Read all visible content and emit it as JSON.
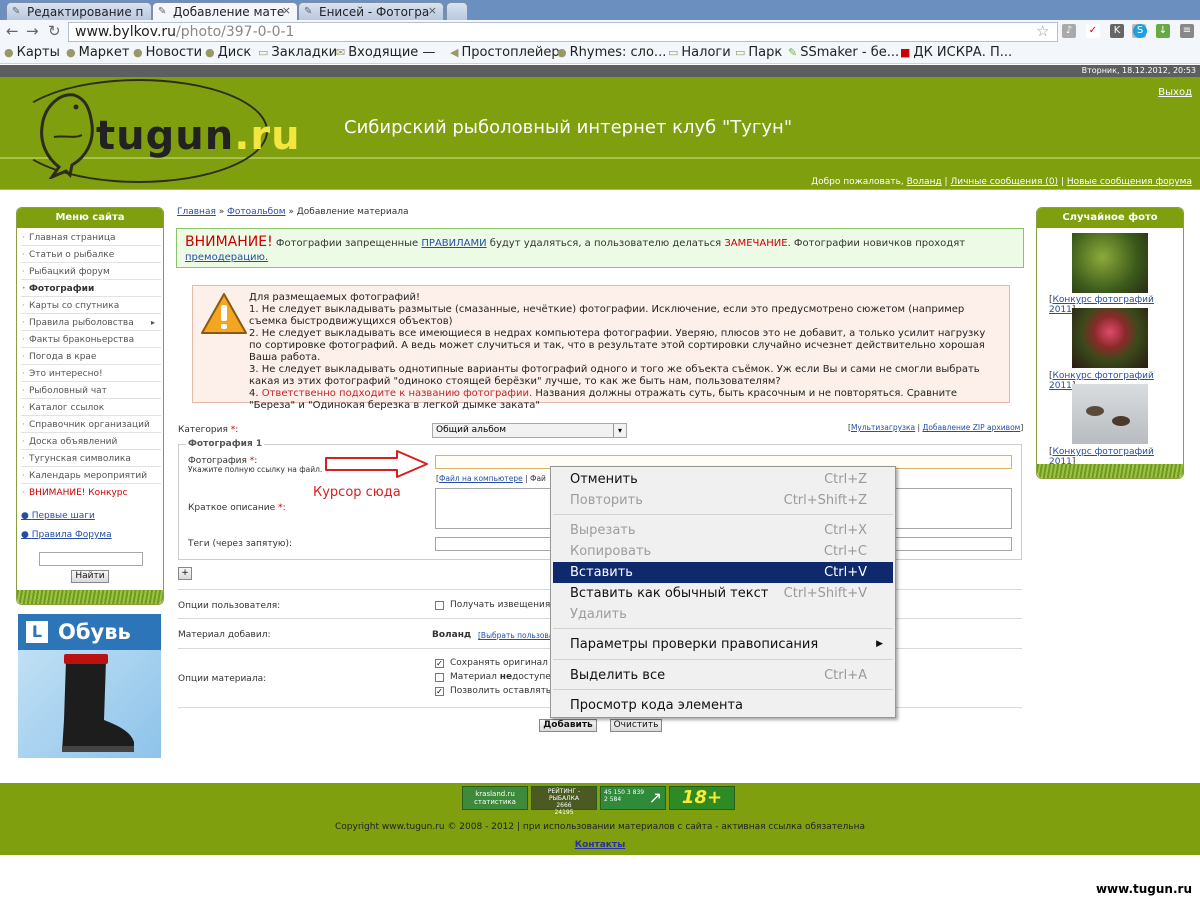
{
  "browser": {
    "tabs": [
      {
        "label": "Редактирование п"
      },
      {
        "label": "Добавление мате"
      },
      {
        "label": "Енисей - Фотогра"
      }
    ],
    "url_host": "www.bylkov.ru",
    "url_path": "/photo/397-0-0-1",
    "bookmarks": [
      "Карты",
      "Маркет",
      "Новости",
      "Диск",
      "Закладки",
      "Входящие —",
      "Простоплейер",
      "Rhymes: сло...",
      "Налоги",
      "Парк",
      "SSmaker - бе...",
      "ДК ИСКРА. П..."
    ]
  },
  "site": {
    "date": "Вторник, 18.12.2012, 20:53",
    "logout": "Выход",
    "logo_main": "tugun",
    "logo_suffix": ".ru",
    "title": "Сибирский рыболовный интернет клуб \"Тугун\"",
    "welcome_prefix": "Добро пожаловать,",
    "user": "Воланд",
    "messages": "Личные сообщения (0)",
    "forum_messages": "Новые сообщения форума"
  },
  "left_menu": {
    "title": "Меню сайта",
    "items": [
      "Главная страница",
      "Статьи о рыбалке",
      "Рыбацкий форум",
      "Фотографии",
      "Карты со спутника",
      "Правила рыболовства",
      "Факты браконьерства",
      "Погода в крае",
      "Это интересно!",
      "Рыболовный чат",
      "Каталог ссылок",
      "Справочник организаций",
      "Доска объявлений",
      "Тугунская символика",
      "Календарь мероприятий",
      "ВНИМАНИЕ! Конкурс"
    ],
    "first_steps": "Первые шаги",
    "forum_rules": "Правила Форума",
    "search_button": "Найти",
    "ad_text": "Обувь"
  },
  "breadcrumb": {
    "home": "Главная",
    "album": "Фотоальбом",
    "current": "Добавление материала"
  },
  "warning": {
    "title": "ВНИМАНИЕ!",
    "text1": "Фотографии запрещенные",
    "rules_link": "ПРАВИЛАМИ",
    "text2": "будут удаляться, а пользователю делаться",
    "remark": "ЗАМЕЧАНИЕ",
    "text3": ". Фотографии новичков проходят",
    "premod": "премодерацию."
  },
  "rules": {
    "intro": "Для размещаемых фотографий!",
    "r1": "1. Не следует выкладывать размытые (смазанные, нечёткие) фотографии. Исключение, если это предусмотрено сюжетом (например съемка быстродвижущихся объектов)",
    "r2": "2. Не следует выкладывать все имеющиеся в недрах компьютера фотографии. Уверяю, плюсов это не добавит, а только усилит нагрузку по сортировке фотографий. А ведь может случиться и так, что в результате этой сортировки случайно исчезнет действительно хорошая Ваша работа.",
    "r3": "3. Не следует выкладывать однотипные варианты фотографий одного и того же объекта съёмок. Уж если Вы и сами не смогли выбрать какая из этих фотографий \"одиноко стоящей берёзки\" лучше, то как же быть нам, пользователям?",
    "r4_prefix": "4.",
    "r4_red": "Ответственно подходите к названию фотографии.",
    "r4_rest": "Названия должны отражать суть, быть красочным и не повторяться. Сравните \"Береза\" и \"Одинокая березка в легкой дымке заката\""
  },
  "form": {
    "category_label": "Категория",
    "category_value": "Общий альбом",
    "multi_upload": "Мультизагрузка",
    "zip_upload": "Добавление ZIP архивом",
    "photo_group": "Фотография 1",
    "photo_label": "Фотография",
    "photo_hint": "Укажите полную ссылку на файл.",
    "file_from_pc": "Файл на компьютере",
    "file_sep": "| Фай",
    "annotation": "Курсор сюда",
    "desc_label": "Краткое описание",
    "tags_label": "Теги (через запятую):",
    "add_more": "+",
    "user_opts_label": "Опции пользователя:",
    "notify_label": "Получать извещения с",
    "added_by_label": "Материал добавил:",
    "added_by_user": "Воланд",
    "choose_user": "[Выбрать пользова",
    "material_opts_label": "Опции материала:",
    "opt_keep": "Сохранять оригинал и",
    "opt_unavail_1": "Материал ",
    "opt_unavail_bold": "не",
    "opt_unavail_2": "доступен",
    "opt_allow": "Позволить оставлять к",
    "required_mark": "*",
    "submit": "Добавить",
    "clear": "Очистить"
  },
  "context_menu": {
    "items": [
      {
        "label": "Отменить",
        "shortcut": "Ctrl+Z"
      },
      {
        "label": "Повторить",
        "shortcut": "Ctrl+Shift+Z"
      },
      {
        "label": "Вырезать",
        "shortcut": "Ctrl+X"
      },
      {
        "label": "Копировать",
        "shortcut": "Ctrl+C"
      },
      {
        "label": "Вставить",
        "shortcut": "Ctrl+V"
      },
      {
        "label": "Вставить как обычный текст",
        "shortcut": "Ctrl+Shift+V"
      },
      {
        "label": "Удалить",
        "shortcut": ""
      },
      {
        "label": "Параметры проверки правописания",
        "shortcut": ""
      },
      {
        "label": "Выделить все",
        "shortcut": "Ctrl+A"
      },
      {
        "label": "Просмотр кода элемента",
        "shortcut": ""
      }
    ]
  },
  "right_panel": {
    "title": "Случайное фото",
    "captions": [
      "Конкурс фотографий 2011",
      "Конкурс фотографий 2011",
      "Конкурс фотографий 2011"
    ]
  },
  "footer": {
    "copyright": "Copyright www.tugun.ru © 2008 - 2012 | при использовании материалов с сайта - активная ссылка обязательна",
    "contacts": "Контакты",
    "counter1_a": "krasland.ru",
    "counter1_b": "статистика",
    "counter2_a": "РЕЙТИНГ - РЫБАЛКА",
    "counter2_b": "2666",
    "counter2_c": "24195",
    "counter3": "45 150 3 839 2 584",
    "badge": "18+",
    "watermark": "www.tugun.ru"
  }
}
